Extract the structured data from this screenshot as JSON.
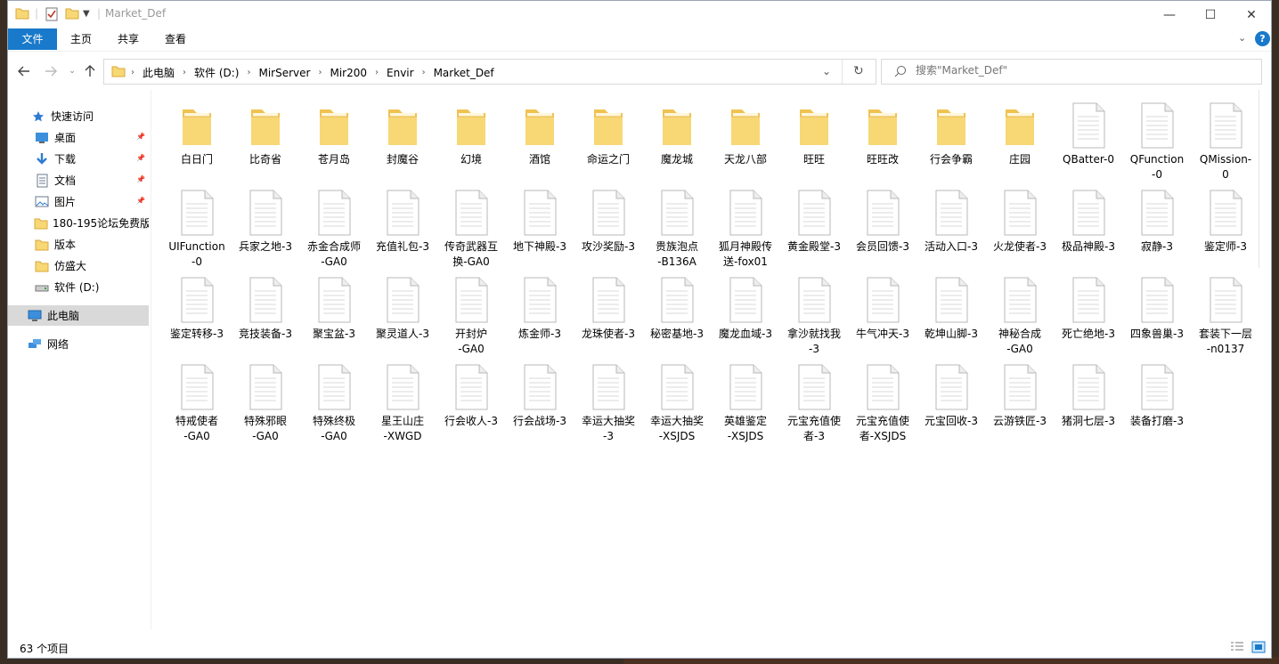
{
  "window": {
    "title": "Market_Def",
    "minimize": "—",
    "maximize": "☐",
    "close": "✕"
  },
  "ribbon": {
    "tabs": [
      "文件",
      "主页",
      "共享",
      "查看"
    ]
  },
  "address": {
    "crumbs": [
      "此电脑",
      "软件 (D:)",
      "MirServer",
      "Mir200",
      "Envir",
      "Market_Def"
    ]
  },
  "search": {
    "placeholder": "搜索\"Market_Def\""
  },
  "sidebar": {
    "items": [
      {
        "label": "快速访问",
        "icon": "star-icon",
        "pinned": false
      },
      {
        "label": "桌面",
        "icon": "desktop-icon",
        "pinned": true
      },
      {
        "label": "下载",
        "icon": "download-icon",
        "pinned": true
      },
      {
        "label": "文档",
        "icon": "document-icon",
        "pinned": true
      },
      {
        "label": "图片",
        "icon": "picture-icon",
        "pinned": true
      },
      {
        "label": "180-195论坛免费版",
        "icon": "folder-icon",
        "pinned": false
      },
      {
        "label": "版本",
        "icon": "folder-icon",
        "pinned": false
      },
      {
        "label": "仿盛大",
        "icon": "folder-icon",
        "pinned": false
      },
      {
        "label": "软件 (D:)",
        "icon": "drive-icon",
        "pinned": false
      },
      {
        "label": "此电脑",
        "icon": "computer-icon",
        "pinned": false
      },
      {
        "label": "网络",
        "icon": "network-icon",
        "pinned": false
      }
    ]
  },
  "files": [
    {
      "name": "白日门",
      "type": "folder"
    },
    {
      "name": "比奇省",
      "type": "folder"
    },
    {
      "name": "苍月岛",
      "type": "folder"
    },
    {
      "name": "封魔谷",
      "type": "folder"
    },
    {
      "name": "幻境",
      "type": "folder"
    },
    {
      "name": "酒馆",
      "type": "folder"
    },
    {
      "name": "命运之门",
      "type": "folder"
    },
    {
      "name": "魔龙城",
      "type": "folder"
    },
    {
      "name": "天龙八部",
      "type": "folder"
    },
    {
      "name": "旺旺",
      "type": "folder"
    },
    {
      "name": "旺旺改",
      "type": "folder"
    },
    {
      "name": "行会争霸",
      "type": "folder"
    },
    {
      "name": "庄园",
      "type": "folder"
    },
    {
      "name": "QBatter-0",
      "type": "file"
    },
    {
      "name": "QFunction\n-0",
      "type": "file"
    },
    {
      "name": "QMission-\n0",
      "type": "file"
    },
    {
      "name": "UIFunction\n-0",
      "type": "file"
    },
    {
      "name": "兵家之地-3",
      "type": "file"
    },
    {
      "name": "赤金合成师\n-GA0",
      "type": "file"
    },
    {
      "name": "充值礼包-3",
      "type": "file"
    },
    {
      "name": "传奇武器互\n换-GA0",
      "type": "file"
    },
    {
      "name": "地下神殿-3",
      "type": "file"
    },
    {
      "name": "攻沙奖励-3",
      "type": "file"
    },
    {
      "name": "贵族泡点\n-B136A",
      "type": "file"
    },
    {
      "name": "狐月神殿传\n送-fox01",
      "type": "file"
    },
    {
      "name": "黄金殿堂-3",
      "type": "file"
    },
    {
      "name": "会员回馈-3",
      "type": "file"
    },
    {
      "name": "活动入口-3",
      "type": "file"
    },
    {
      "name": "火龙使者-3",
      "type": "file"
    },
    {
      "name": "极品神殿-3",
      "type": "file"
    },
    {
      "name": "寂静-3",
      "type": "file"
    },
    {
      "name": "鉴定师-3",
      "type": "file"
    },
    {
      "name": "鉴定转移-3",
      "type": "file"
    },
    {
      "name": "竞技装备-3",
      "type": "file"
    },
    {
      "name": "聚宝盆-3",
      "type": "file"
    },
    {
      "name": "聚灵道人-3",
      "type": "file"
    },
    {
      "name": "开封炉\n-GA0",
      "type": "file"
    },
    {
      "name": "炼金师-3",
      "type": "file"
    },
    {
      "name": "龙珠使者-3",
      "type": "file"
    },
    {
      "name": "秘密基地-3",
      "type": "file"
    },
    {
      "name": "魔龙血域-3",
      "type": "file"
    },
    {
      "name": "拿沙就找我\n-3",
      "type": "file"
    },
    {
      "name": "牛气冲天-3",
      "type": "file"
    },
    {
      "name": "乾坤山脚-3",
      "type": "file"
    },
    {
      "name": "神秘合成\n-GA0",
      "type": "file"
    },
    {
      "name": "死亡绝地-3",
      "type": "file"
    },
    {
      "name": "四象兽巢-3",
      "type": "file"
    },
    {
      "name": "套装下一层\n-n0137",
      "type": "file"
    },
    {
      "name": "特戒使者\n-GA0",
      "type": "file"
    },
    {
      "name": "特殊邪眼\n-GA0",
      "type": "file"
    },
    {
      "name": "特殊终极\n-GA0",
      "type": "file"
    },
    {
      "name": "星王山庄\n-XWGD",
      "type": "file"
    },
    {
      "name": "行会收人-3",
      "type": "file"
    },
    {
      "name": "行会战场-3",
      "type": "file"
    },
    {
      "name": "幸运大抽奖\n-3",
      "type": "file"
    },
    {
      "name": "幸运大抽奖\n-XSJDS",
      "type": "file"
    },
    {
      "name": "英雄鉴定\n-XSJDS",
      "type": "file"
    },
    {
      "name": "元宝充值使\n者-3",
      "type": "file"
    },
    {
      "name": "元宝充值使\n者-XSJDS",
      "type": "file"
    },
    {
      "name": "元宝回收-3",
      "type": "file"
    },
    {
      "name": "云游铁匠-3",
      "type": "file"
    },
    {
      "name": "猪洞七层-3",
      "type": "file"
    },
    {
      "name": "装备打磨-3",
      "type": "file"
    }
  ],
  "status": {
    "count": "63 个项目"
  },
  "colors": {
    "accent": "#1979ca",
    "folder": "#f8d775",
    "selected": "#cce8ff"
  }
}
